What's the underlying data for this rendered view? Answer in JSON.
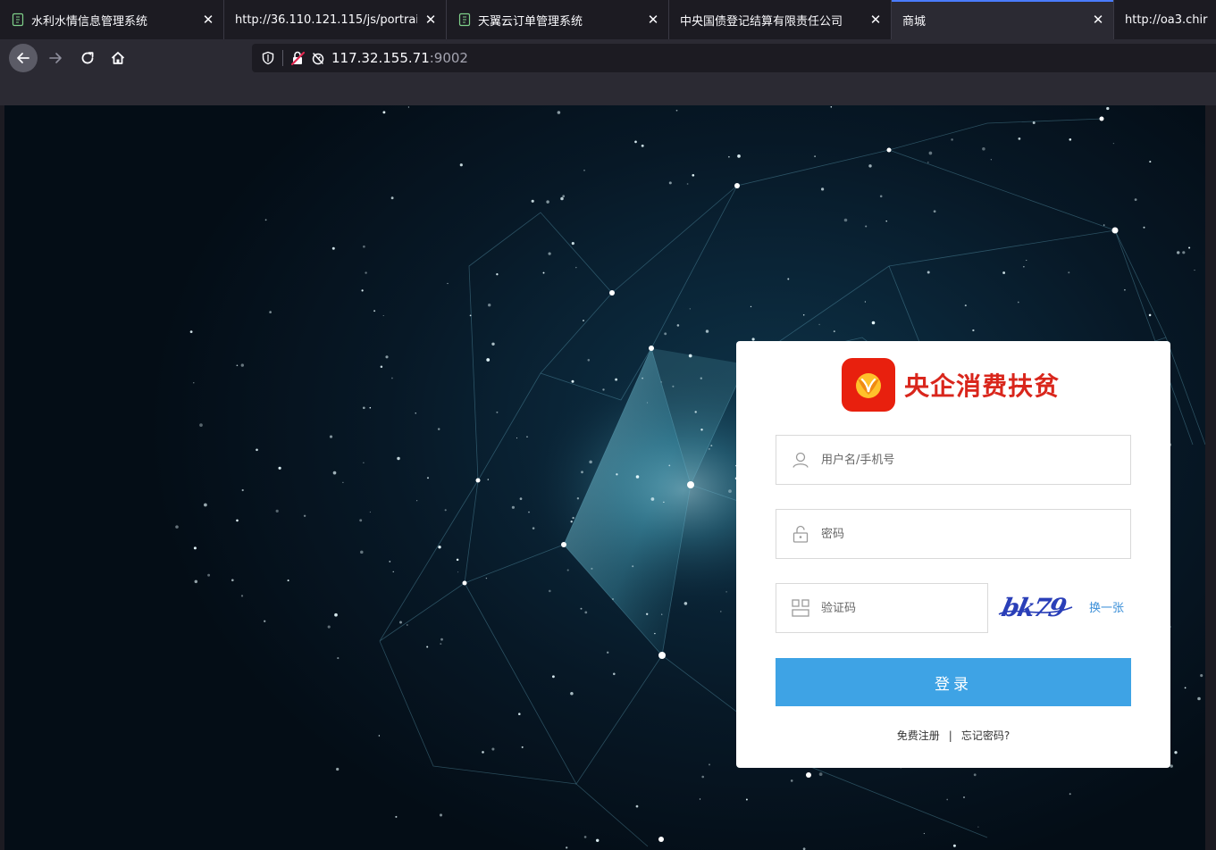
{
  "browser": {
    "tabs": [
      {
        "title": "水利水情信息管理系统",
        "favicon": "doc-icon",
        "active": false
      },
      {
        "title": "http://36.110.121.115/js/portrait",
        "favicon": "",
        "active": false
      },
      {
        "title": "天翼云订单管理系统",
        "favicon": "doc-icon",
        "active": false
      },
      {
        "title": "中央国债登记结算有限责任公司",
        "favicon": "",
        "active": false
      },
      {
        "title": "商城",
        "favicon": "",
        "active": true
      },
      {
        "title": "http://oa3.chir",
        "favicon": "",
        "active": false
      }
    ],
    "close_glyph": "✕",
    "url_host": "117.32.155.71",
    "url_port": ":9002"
  },
  "login": {
    "brand_name": "央企消费扶贫",
    "username_placeholder": "用户名/手机号",
    "password_placeholder": "密码",
    "captcha_placeholder": "验证码",
    "captcha_text": "bk79",
    "refresh_label": "换一张",
    "submit_label": "登录",
    "register_label": "免费注册",
    "separator": "|",
    "forgot_label": "忘记密码?"
  },
  "colors": {
    "brand_red": "#d9261c",
    "button_blue": "#3ea3e5",
    "link_blue": "#3b8fd8"
  }
}
